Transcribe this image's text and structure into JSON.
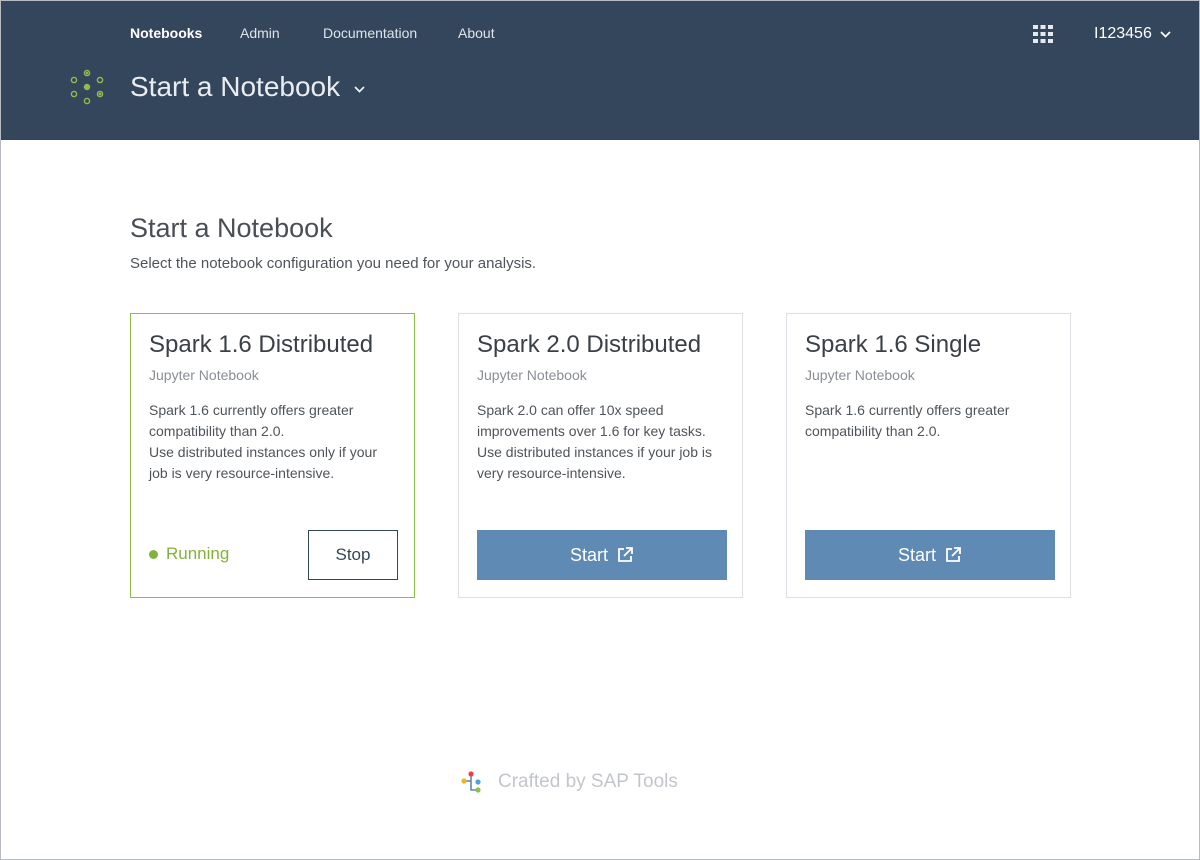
{
  "nav": {
    "items": [
      {
        "label": "Notebooks",
        "active": true
      },
      {
        "label": "Admin",
        "active": false
      },
      {
        "label": "Documentation",
        "active": false
      },
      {
        "label": "About",
        "active": false
      }
    ],
    "apps_icon": "grid-icon",
    "user": "I123456"
  },
  "app": {
    "title": "Start a Notebook",
    "logo_icon": "dots-circle-logo",
    "logo_color": "#8fbd4a"
  },
  "main": {
    "title": "Start a Notebook",
    "subtitle": "Select the notebook configuration you need for your analysis."
  },
  "cards": [
    {
      "title": "Spark 1.6 Distributed",
      "type": "Jupyter Notebook",
      "description": [
        "Spark 1.6 currently offers greater",
        "compatibility than 2.0.",
        "Use distributed instances only if your",
        "job is very resource-intensive."
      ],
      "status": "Running",
      "status_color": "#83b13d",
      "action_label": "Stop"
    },
    {
      "title": "Spark 2.0 Distributed",
      "type": "Jupyter Notebook",
      "description": [
        "Spark 2.0 can offer 10x speed",
        "improvements over 1.6 for key tasks.",
        "Use distributed instances if your job is",
        "very resource-intensive."
      ],
      "action_label": "Start",
      "action_icon": "external-link-icon"
    },
    {
      "title": "Spark 1.6 Single",
      "type": "Jupyter Notebook",
      "description": [
        "Spark 1.6 currently offers greater",
        "compatibility than 2.0."
      ],
      "action_label": "Start",
      "action_icon": "external-link-icon"
    }
  ],
  "footer": {
    "text": "Crafted by SAP Tools",
    "logo_icon": "sap-tools-logo"
  },
  "colors": {
    "header_bg": "#34465c",
    "accent_green": "#8fbd4a",
    "primary_button": "#5f8ab3"
  }
}
